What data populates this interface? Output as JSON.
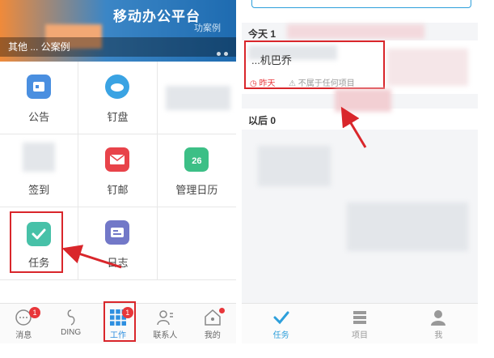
{
  "left": {
    "banner": {
      "title": "移动办公平台",
      "subtitle": "功案例",
      "caption": "其他 ... 公案例"
    },
    "grid": [
      {
        "label": "公告",
        "icon": "announcement-icon",
        "color": "#4a8fe0"
      },
      {
        "label": "钉盘",
        "icon": "cloud-drive-icon",
        "color": "#3aa3e3"
      },
      {
        "label": "",
        "icon": "blurred-icon",
        "color": "#e3e6ea"
      },
      {
        "label": "签到",
        "icon": "check-in-icon",
        "color": "#e3e6ea"
      },
      {
        "label": "钉邮",
        "icon": "mail-icon",
        "color": "#e8434a"
      },
      {
        "label": "管理日历",
        "icon": "calendar-icon",
        "color": "#3cbf86",
        "day": "26"
      },
      {
        "label": "任务",
        "icon": "task-check-icon",
        "color": "#47c1a8"
      },
      {
        "label": "日志",
        "icon": "log-icon",
        "color": "#7278c8"
      },
      {
        "label": "",
        "icon": "empty-slot",
        "color": "#ffffff"
      }
    ],
    "tabbar": [
      {
        "label": "消息",
        "icon": "message-icon",
        "badge": "1"
      },
      {
        "label": "DING",
        "icon": "ding-icon",
        "badge": ""
      },
      {
        "label": "工作",
        "icon": "work-grid-icon",
        "badge": "1"
      },
      {
        "label": "联系人",
        "icon": "contacts-icon",
        "badge": ""
      },
      {
        "label": "我的",
        "icon": "me-icon",
        "badge": ""
      }
    ]
  },
  "right": {
    "today_header": "今天 1",
    "task": {
      "name": "...机巴乔",
      "due": "昨天",
      "project": "不属于任何项目"
    },
    "later_header": "以后 0",
    "tabbar": [
      {
        "label": "任务",
        "icon": "task-tab-icon",
        "active": true
      },
      {
        "label": "项目",
        "icon": "project-tab-icon",
        "active": false
      },
      {
        "label": "我",
        "icon": "profile-tab-icon",
        "active": false
      }
    ]
  },
  "colors": {
    "accent": "#2d9fdb",
    "highlight": "#d9262b",
    "badge": "#e8363a"
  }
}
